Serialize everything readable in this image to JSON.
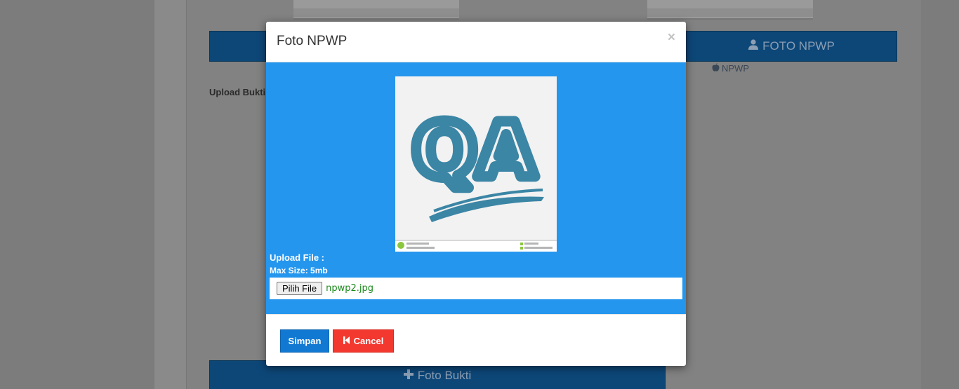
{
  "modal": {
    "title": "Foto NPWP",
    "close_label": "×",
    "upload_label": "Upload File :",
    "max_size_label": "Max Size: 5mb",
    "file_button_label": "Pilih File",
    "file_name": "npwp2.jpg",
    "preview_text": "QA",
    "save_label": "Simpan",
    "cancel_label": "Cancel"
  },
  "background": {
    "foto_npwp_button_label": "FOTO NPWP",
    "npwp_caption": "NPWP",
    "upload_bukti_label": "Upload Bukti",
    "foto_bukti_button_label": "Foto Bukti"
  },
  "icons": {
    "close": "close-icon",
    "cancel": "step-backward-icon",
    "user": "user-icon",
    "apple": "apple-icon",
    "plus": "plus-icon"
  },
  "colors": {
    "modal_body": "#2596ee",
    "save_button": "#1179d2",
    "cancel_button": "#f2382f",
    "file_name": "#1e8a1e"
  }
}
